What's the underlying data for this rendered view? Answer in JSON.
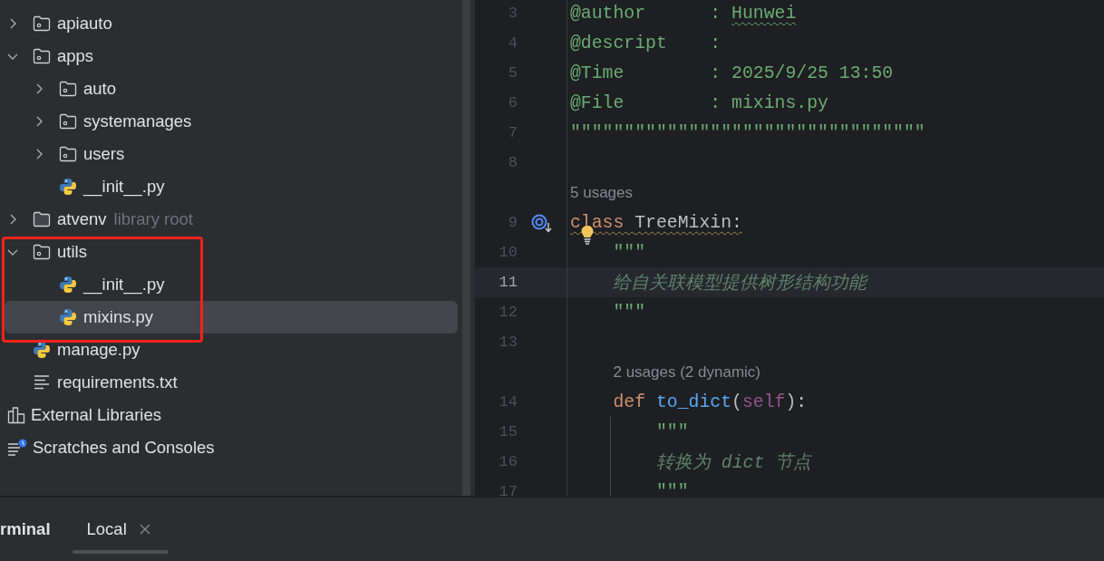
{
  "project_tree": [
    {
      "name": "apiauto",
      "kind": "folder",
      "expanded": false,
      "selected": false
    },
    {
      "name": "apps",
      "kind": "folder",
      "expanded": true,
      "selected": false,
      "children": [
        {
          "name": "auto",
          "kind": "folder",
          "expanded": false,
          "selected": false
        },
        {
          "name": "systemanages",
          "kind": "folder",
          "expanded": false,
          "selected": false
        },
        {
          "name": "users",
          "kind": "folder",
          "expanded": false,
          "selected": false
        },
        {
          "name": "__init__.py",
          "kind": "python",
          "selected": false
        }
      ]
    },
    {
      "name": "atvenv",
      "kind": "venv",
      "expanded": false,
      "selected": false,
      "hint": "library root"
    },
    {
      "name": "utils",
      "kind": "folder",
      "expanded": true,
      "selected": false,
      "children": [
        {
          "name": "__init__.py",
          "kind": "python",
          "selected": false
        },
        {
          "name": "mixins.py",
          "kind": "python",
          "selected": true
        }
      ]
    },
    {
      "name": "manage.py",
      "kind": "python",
      "selected": false
    },
    {
      "name": "requirements.txt",
      "kind": "text",
      "selected": false
    }
  ],
  "extra_nodes": [
    {
      "name": "External Libraries",
      "kind": "libraries",
      "selected": false
    },
    {
      "name": "Scratches and Consoles",
      "kind": "scratches",
      "selected": false
    }
  ],
  "editor_lines": [
    {
      "kind": "code",
      "number": "3",
      "tokens": [
        {
          "doc": "@author      : "
        },
        {
          "doc": "Hunwei",
          "typo": true
        }
      ]
    },
    {
      "kind": "code",
      "number": "4",
      "tokens": [
        {
          "doc": "@descript    :"
        }
      ]
    },
    {
      "kind": "code",
      "number": "5",
      "tokens": [
        {
          "doc": "@Time        : 2025/9/25 13:50"
        }
      ]
    },
    {
      "kind": "code",
      "number": "6",
      "tokens": [
        {
          "doc": "@File        : mixins.py"
        }
      ]
    },
    {
      "kind": "code",
      "number": "7",
      "tokens": [
        {
          "doc": "\"\"\"\"\"\"\"\"\"\"\"\"\"\"\"\"\"\"\"\"\"\"\"\"\"\"\"\"\"\"\"\"\""
        }
      ]
    },
    {
      "kind": "code",
      "number": "8"
    },
    {
      "kind": "hint",
      "text": "5 usages"
    },
    {
      "kind": "code",
      "number": "9",
      "override_marker": true,
      "tokens": [
        {
          "keyword": "class ",
          "warning": true
        },
        {
          "name": "TreeMixin:",
          "warning": true
        }
      ]
    },
    {
      "kind": "code",
      "number": "10",
      "bulb": true,
      "tokens": [
        {
          "doc": "    \"\"\""
        }
      ]
    },
    {
      "kind": "code",
      "number": "11",
      "current": true,
      "tokens": [
        {
          "docitalic": "    给自关联模型提供树形结构功能"
        }
      ]
    },
    {
      "kind": "code",
      "number": "12",
      "tokens": [
        {
          "doc": "    \"\"\""
        }
      ]
    },
    {
      "kind": "code",
      "number": "13"
    },
    {
      "kind": "hint",
      "text": "    2 usages (2 dynamic)"
    },
    {
      "kind": "code",
      "number": "14",
      "tokens": [
        {
          "keyword": "    def "
        },
        {
          "fn": "to_dict"
        },
        {
          "name": "("
        },
        {
          "self": "self"
        },
        {
          "name": "):"
        }
      ]
    },
    {
      "kind": "code",
      "number": "15",
      "guide": true,
      "tokens": [
        {
          "doc": "        \"\"\""
        }
      ]
    },
    {
      "kind": "code",
      "number": "16",
      "guide": true,
      "tokens": [
        {
          "docitalic": "        转换为 dict 节点"
        }
      ]
    },
    {
      "kind": "code",
      "number": "17",
      "guide": true,
      "tokens": [
        {
          "doc": "        \"\"\""
        }
      ]
    }
  ],
  "bottom_panel": {
    "title": "rminal",
    "tabs": [
      {
        "label": "Local",
        "selected": true
      }
    ]
  }
}
